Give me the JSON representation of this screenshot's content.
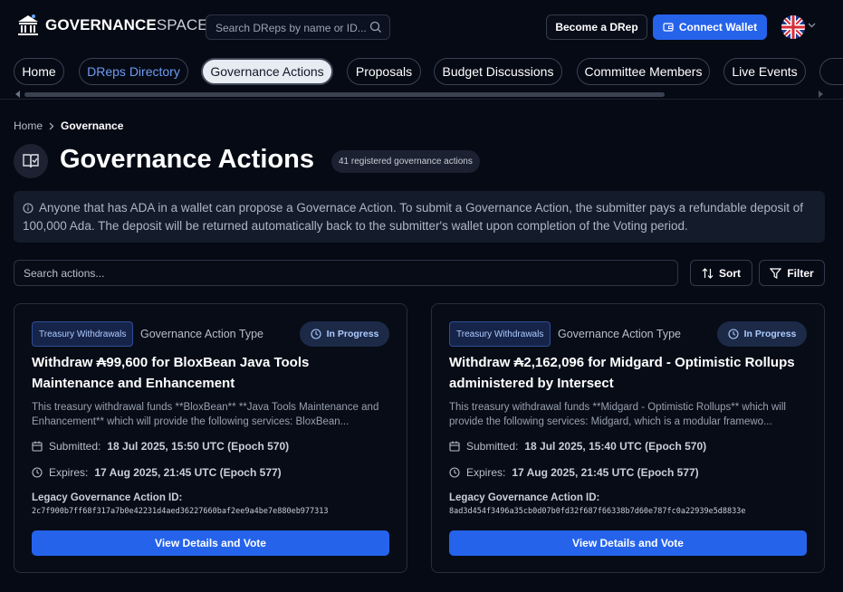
{
  "header": {
    "logo_bold": "GOVERNANCE",
    "logo_light": "SPACE",
    "search_placeholder": "Search DReps by name or ID...",
    "become_drep": "Become a DRep",
    "connect_wallet": "Connect Wallet",
    "language_icon": "uk-flag-icon"
  },
  "nav": {
    "items": [
      {
        "label": "Home"
      },
      {
        "label": "DReps Directory"
      },
      {
        "label": "Governance Actions"
      },
      {
        "label": "Proposals"
      },
      {
        "label": "Budget Discussions"
      },
      {
        "label": "Committee Members"
      },
      {
        "label": "Live Events"
      }
    ],
    "active": "Governance Actions"
  },
  "breadcrumb": {
    "home": "Home",
    "current": "Governance"
  },
  "page": {
    "title": "Governance Actions",
    "count_badge": "41 registered governance actions",
    "info": "Anyone that has ADA in a wallet can propose a Governace Action. To submit a Governance Action, the submitter pays a refundable deposit of 100,000 Ada. The deposit will be returned automatically back to the submitter's wallet upon completion of the Voting period.",
    "search_placeholder": "Search actions...",
    "sort_label": "Sort",
    "filter_label": "Filter"
  },
  "cards": [
    {
      "tag": "Treasury Withdrawals",
      "type_label": "Governance Action Type",
      "status": "In Progress",
      "title": "Withdraw ₳99,600 for BloxBean Java Tools Maintenance and Enhancement",
      "description": "This treasury withdrawal funds **BloxBean** **Java Tools Maintenance and Enhancement** which will provide the following services: BloxBean...",
      "submitted_label": "Submitted:",
      "submitted": "18 Jul 2025, 15:50 UTC (Epoch 570)",
      "expires_label": "Expires:",
      "expires": "17 Aug 2025, 21:45 UTC (Epoch 577)",
      "legacy_label": "Legacy Governance Action ID:",
      "legacy_id": "2c7f900b7ff68f317a7b0e42231d4aed36227660baf2ee9a4be7e880eb977313",
      "vote_label": "View Details and Vote"
    },
    {
      "tag": "Treasury Withdrawals",
      "type_label": "Governance Action Type",
      "status": "In Progress",
      "title": "Withdraw ₳2,162,096 for Midgard - Optimistic Rollups administered by Intersect",
      "description": "This treasury withdrawal funds **Midgard - Optimistic Rollups** which will provide the following services: Midgard, which is a modular framewo...",
      "submitted_label": "Submitted:",
      "submitted": "18 Jul 2025, 15:40 UTC (Epoch 570)",
      "expires_label": "Expires:",
      "expires": "17 Aug 2025, 21:45 UTC (Epoch 577)",
      "legacy_label": "Legacy Governance Action ID:",
      "legacy_id": "8ad3d454f3496a35cb0d07b0fd32f687f66338b7d60e787fc0a22939e5d8833e",
      "vote_label": "View Details and Vote"
    }
  ],
  "colors": {
    "background": "#060a15",
    "accent": "#2563eb",
    "tag_bg": "#16244a",
    "status_bg": "#1c2a48"
  }
}
